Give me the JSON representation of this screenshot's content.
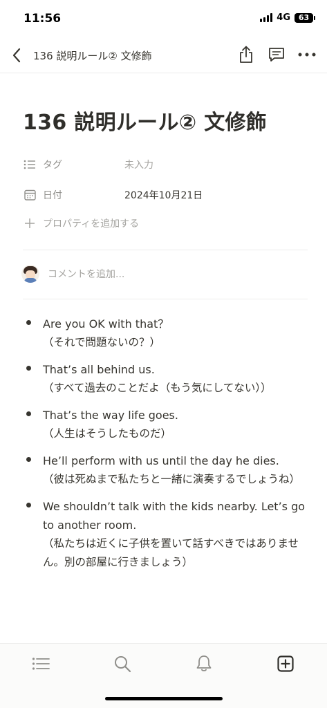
{
  "status_bar": {
    "time": "11:56",
    "network": "4G",
    "battery": "63"
  },
  "nav": {
    "title": "136 説明ルール② 文修飾",
    "back_icon": "chevron-left-icon",
    "share_icon": "share-icon",
    "comments_icon": "comment-icon",
    "more_icon": "more-icon"
  },
  "page": {
    "title": "136 説明ルール② 文修飾",
    "properties": [
      {
        "name": "タグ",
        "value": "未入力",
        "icon": "list-icon",
        "empty": true
      },
      {
        "name": "日付",
        "value": "2024年10月21日",
        "icon": "calendar-icon",
        "empty": false
      }
    ],
    "add_property": "プロパティを追加する",
    "comment_placeholder": "コメントを追加..."
  },
  "bullets": [
    {
      "en": "Are you OK with that？",
      "ja": "（それで問題ないの？）"
    },
    {
      "en": "That’s all behind us.",
      "ja": "（すべて過去のことだよ（もう気にしてない））"
    },
    {
      "en": "That’s the way life goes.",
      "ja": "（人生はそうしたものだ）"
    },
    {
      "en": "He’ll perform with us until the day he dies.",
      "ja": "（彼は死ぬまで私たちと一緒に演奏するでしょうね）"
    },
    {
      "en": "We shouldn’t talk with the kids nearby. Let’s go to another room.",
      "ja": "（私たちは近くに子供を置いて話すべきではありません。別の部屋に行きましょう）"
    }
  ],
  "tab_bar": {
    "items": [
      "list-icon",
      "search-icon",
      "bell-icon",
      "new-page-icon"
    ]
  },
  "colors": {
    "text": "#37352f",
    "muted": "#8f8e8a",
    "placeholder": "#a5a4a0",
    "divider": "#ececeb"
  }
}
